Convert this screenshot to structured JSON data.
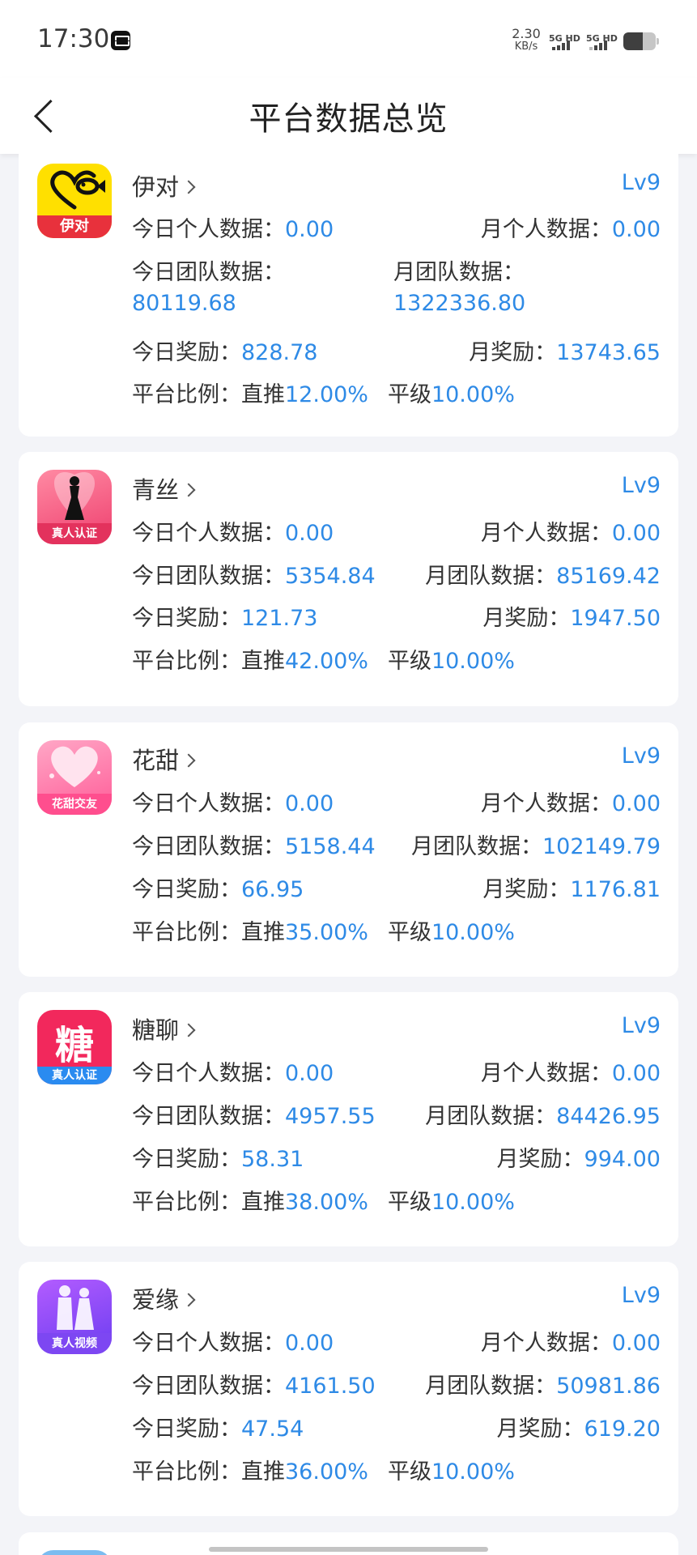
{
  "status_bar": {
    "time": "17:30",
    "net_speed_value": "2.30",
    "net_speed_unit": "KB/s",
    "signal_1_label": "5G HD",
    "signal_2_label": "5G HD"
  },
  "nav": {
    "title": "平台数据总览"
  },
  "labels": {
    "today_personal": "今日个人数据：",
    "month_personal": "月个人数据：",
    "today_team": "今日团队数据：",
    "month_team": "月团队数据：",
    "today_reward": "今日奖励：",
    "month_reward": "月奖励：",
    "ratio": "平台比例：",
    "direct": "直推",
    "level": "平级"
  },
  "platforms": [
    {
      "name": "伊对",
      "icon": "yidui-logo-icon",
      "icon_text": "伊对",
      "level": "Lv9",
      "today_personal": "0.00",
      "month_personal": "0.00",
      "today_team": "80119.68",
      "month_team": "1322336.80",
      "today_reward": "828.78",
      "month_reward": "13743.65",
      "direct_ratio": "12.00%",
      "level_ratio": "10.00%"
    },
    {
      "name": "青丝",
      "icon": "qingsi-logo-icon",
      "icon_text": "真人认证",
      "level": "Lv9",
      "today_personal": "0.00",
      "month_personal": "0.00",
      "today_team": "5354.84",
      "month_team": "85169.42",
      "today_reward": "121.73",
      "month_reward": "1947.50",
      "direct_ratio": "42.00%",
      "level_ratio": "10.00%"
    },
    {
      "name": "花甜",
      "icon": "huatian-logo-icon",
      "icon_text": "花甜交友",
      "level": "Lv9",
      "today_personal": "0.00",
      "month_personal": "0.00",
      "today_team": "5158.44",
      "month_team": "102149.79",
      "today_reward": "66.95",
      "month_reward": "1176.81",
      "direct_ratio": "35.00%",
      "level_ratio": "10.00%"
    },
    {
      "name": "糖聊",
      "icon": "tangliao-logo-icon",
      "icon_text": "真人认证",
      "icon_glyph": "糖",
      "level": "Lv9",
      "today_personal": "0.00",
      "month_personal": "0.00",
      "today_team": "4957.55",
      "month_team": "84426.95",
      "today_reward": "58.31",
      "month_reward": "994.00",
      "direct_ratio": "38.00%",
      "level_ratio": "10.00%"
    },
    {
      "name": "爱缘",
      "icon": "aiyuan-logo-icon",
      "icon_text": "真人视频",
      "level": "Lv9",
      "today_personal": "0.00",
      "month_personal": "0.00",
      "today_team": "4161.50",
      "month_team": "50981.86",
      "today_reward": "47.54",
      "month_reward": "619.20",
      "direct_ratio": "36.00%",
      "level_ratio": "10.00%"
    }
  ],
  "colors": {
    "accent": "#2e8ae6",
    "background": "#f3f4f8",
    "card": "#ffffff"
  }
}
